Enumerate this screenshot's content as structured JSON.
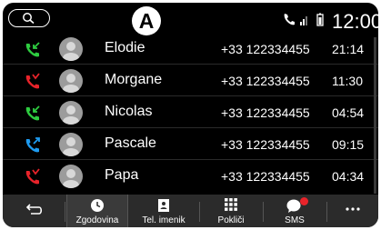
{
  "marker": {
    "label": "A"
  },
  "status": {
    "time": "12:00"
  },
  "calls": [
    {
      "name": "Elodie",
      "number": "+33 122334455",
      "time": "21:14",
      "type": "incoming",
      "color": "#2ecc40"
    },
    {
      "name": "Morgane",
      "number": "+33 122334455",
      "time": "11:30",
      "type": "missed",
      "color": "#e8232a"
    },
    {
      "name": "Nicolas",
      "number": "+33 122334455",
      "time": "04:54",
      "type": "incoming",
      "color": "#2ecc40"
    },
    {
      "name": "Pascale",
      "number": "+33 122334455",
      "time": "09:15",
      "type": "outgoing",
      "color": "#1e9bf0"
    },
    {
      "name": "Papa",
      "number": "+33 122334455",
      "time": "04:34",
      "type": "missed",
      "color": "#e8232a"
    }
  ],
  "bottom_nav": {
    "back_icon": "back-arrow-icon",
    "history": "Zgodovina",
    "contacts": "Tel. imenik",
    "dial": "Pokliči",
    "sms": "SMS",
    "more_icon": "more-dots-icon"
  },
  "colors": {
    "background": "#000000",
    "nav_bar": "#2b2b2b",
    "missed": "#e8232a",
    "incoming": "#2ecc40",
    "outgoing": "#1e9bf0"
  }
}
